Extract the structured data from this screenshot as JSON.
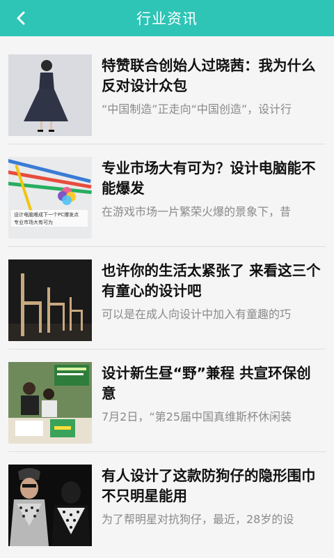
{
  "header": {
    "title": "行业资讯",
    "back_icon": "chevron-left-icon",
    "background": "#2ec4b6"
  },
  "articles": [
    {
      "title": "特赞联合创始人过晓茜：我为什么反对设计众包",
      "summary": "“中国制造”正走向“中国创造”，设计行"
    },
    {
      "title": "专业市场大有可为？设计电脑能不能爆发",
      "summary": "在游戏市场一片繁荣火爆的景象下，昔",
      "thumb_caption_1": "设计电脑难成下一个PC爆发点",
      "thumb_caption_2": "专业市场大有可为"
    },
    {
      "title": "也许你的生活太紧张了 来看这三个有童心的设计吧",
      "summary": "可以是在成人向设计中加入有童趣的巧"
    },
    {
      "title": "设计新生昼“野”兼程 共宣环保创意",
      "summary": "7月2日，“第25届中国真维斯杯休闲装"
    },
    {
      "title": "有人设计了这款防狗仔的隐形围巾 不只明星能用",
      "summary": "为了帮明星对抗狗仔，最近，28岁的设"
    }
  ]
}
